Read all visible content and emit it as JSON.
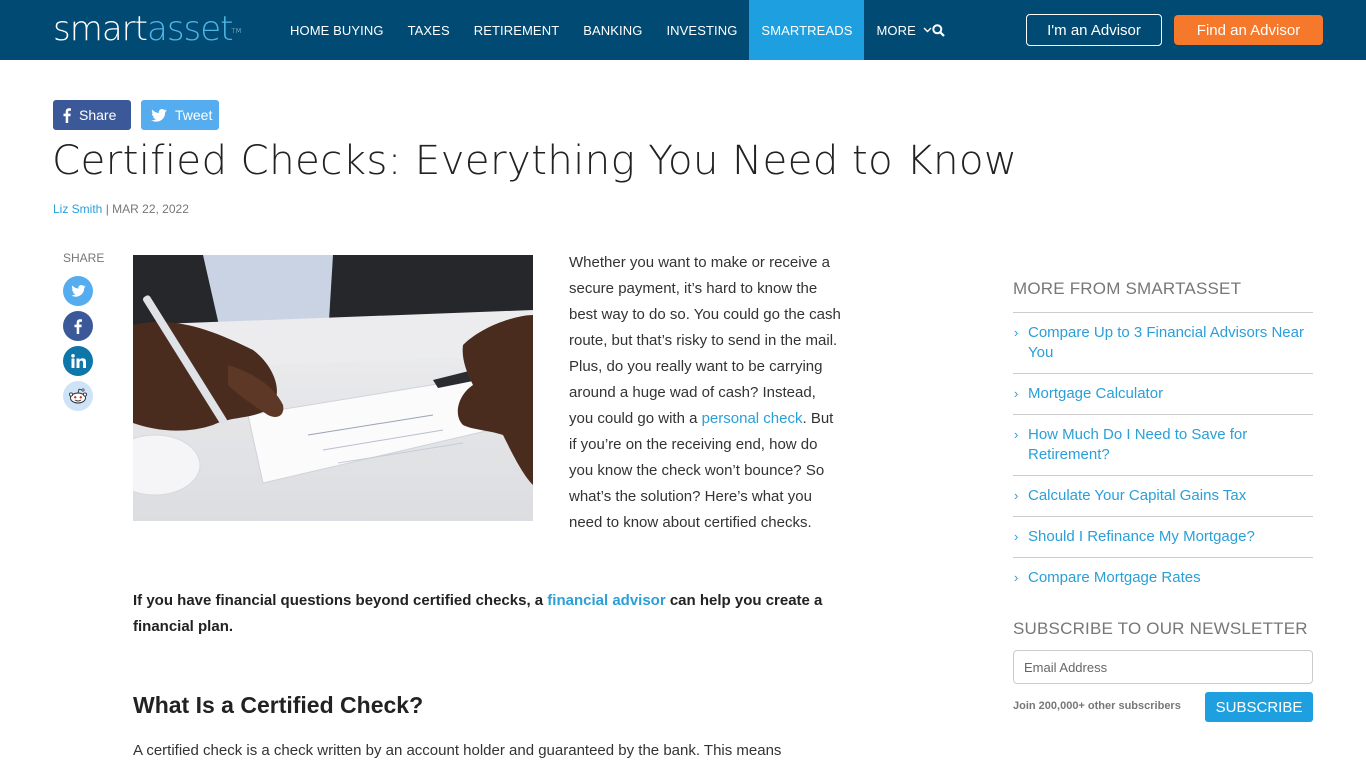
{
  "header": {
    "logo_part1": "smart",
    "logo_part2": "asset",
    "logo_tm": "TM",
    "nav": [
      {
        "label": "HOME BUYING"
      },
      {
        "label": "TAXES"
      },
      {
        "label": "RETIREMENT"
      },
      {
        "label": "BANKING"
      },
      {
        "label": "INVESTING"
      },
      {
        "label": "SMARTREADS",
        "active": true
      },
      {
        "label": "MORE"
      }
    ],
    "advisor_button": "I'm an Advisor",
    "find_button": "Find an Advisor",
    "colors": {
      "nav_bg": "#004a73",
      "active_tab": "#1ea0e0",
      "cta": "#f6782a"
    }
  },
  "share_bar": {
    "facebook": "Share",
    "twitter": "Tweet"
  },
  "article": {
    "title": "Certified Checks: Everything You Need to Know",
    "author": "Liz Smith",
    "separator": " | ",
    "date": "MAR 22, 2022",
    "share_label": "SHARE",
    "social_icons": [
      "twitter-icon",
      "facebook-icon",
      "linkedin-icon",
      "reddit-icon"
    ],
    "intro_before": "Whether you want to make or receive a secure payment, it’s hard to know the best way to do so. You could go the cash route, but that’s risky to send in the mail. Plus, do you really want to be carrying around a huge wad of cash? Instead, you could go with a ",
    "intro_link": "personal check",
    "intro_after": ". But if you’re on the receiving end, how do you know the check won’t bounce? So what’s the solution? Here’s what you need to know about certified checks.",
    "callout_before": "If you have financial questions beyond certified checks, a ",
    "callout_link": "financial advisor",
    "callout_after": " can help you create a financial plan.",
    "heading": "What Is a Certified Check?",
    "paragraph": "A certified check is a check written by an account holder and guaranteed by the bank. This means"
  },
  "sidebar": {
    "more_heading": "MORE FROM SMARTASSET",
    "links": [
      {
        "label": "Compare Up to 3 Financial Advisors Near You"
      },
      {
        "label": "Mortgage Calculator"
      },
      {
        "label": "How Much Do I Need to Save for Retirement?"
      },
      {
        "label": "Calculate Your Capital Gains Tax"
      },
      {
        "label": "Should I Refinance My Mortgage?"
      },
      {
        "label": "Compare Mortgage Rates"
      }
    ],
    "newsletter_heading": "SUBSCRIBE TO OUR NEWSLETTER",
    "email_placeholder": "Email Address",
    "join_text": "Join 200,000+ other subscribers",
    "subscribe_button": "SUBSCRIBE"
  }
}
